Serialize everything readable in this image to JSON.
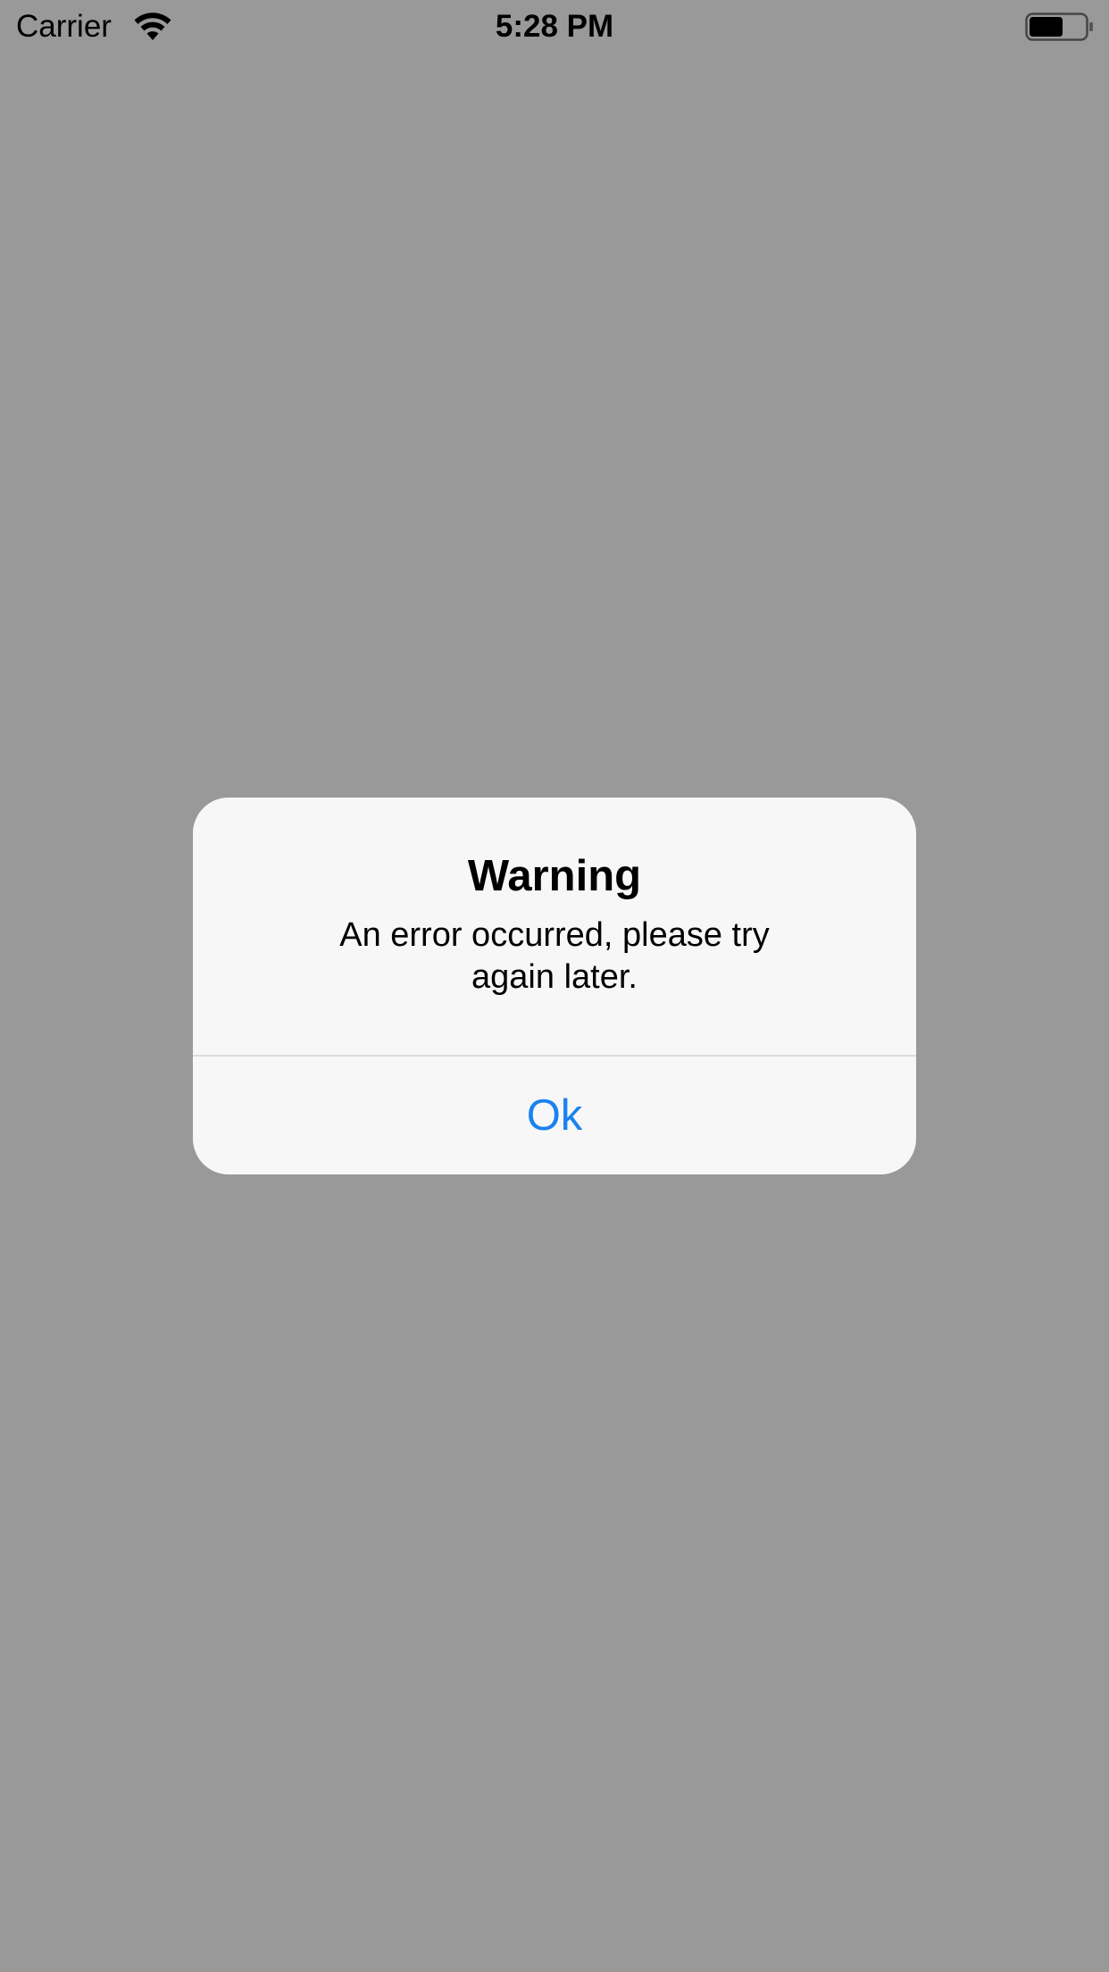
{
  "status_bar": {
    "carrier": "Carrier",
    "time": "5:28 PM",
    "wifi_icon": "wifi-icon",
    "battery_icon": "battery-icon",
    "battery_level": 0.6
  },
  "alert": {
    "title": "Warning",
    "message": "An error occurred, please try again later.",
    "button_label": "Ok"
  },
  "colors": {
    "dimmed_background": "#999999",
    "alert_background": "#f7f7f7",
    "button_tint": "#1a82f0"
  }
}
